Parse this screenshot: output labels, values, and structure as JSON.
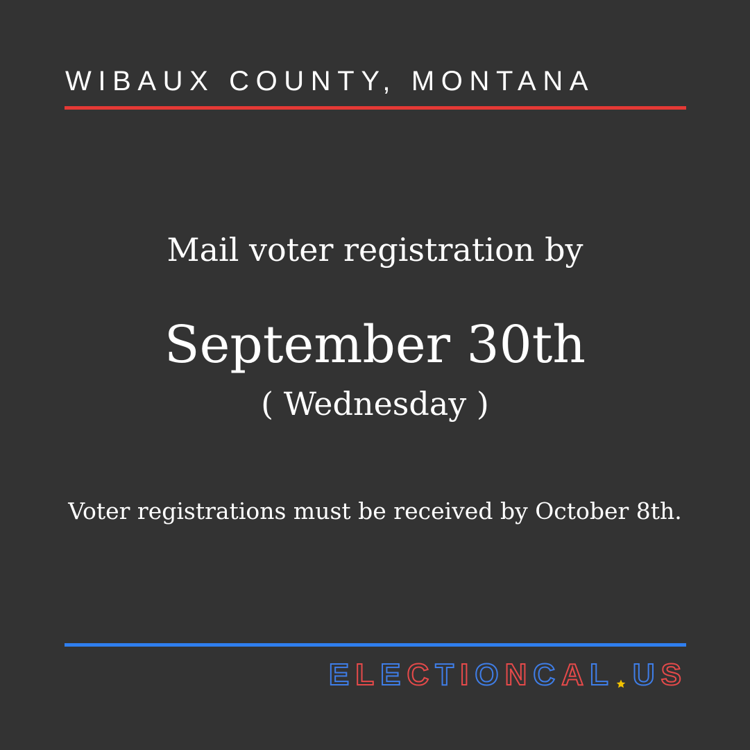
{
  "header": {
    "county": "WIBAUX COUNTY, MONTANA"
  },
  "main": {
    "headline": "Mail voter registration by",
    "date": "September 30th",
    "weekday": "( Wednesday )",
    "note": "Voter registrations must be received by October 8th."
  },
  "footer": {
    "brand_text": "ELECTIONCAL.US",
    "brand_letters": [
      {
        "char": "E",
        "color": "blue"
      },
      {
        "char": "L",
        "color": "red"
      },
      {
        "char": "E",
        "color": "blue"
      },
      {
        "char": "C",
        "color": "red"
      },
      {
        "char": "T",
        "color": "blue"
      },
      {
        "char": "I",
        "color": "red"
      },
      {
        "char": "O",
        "color": "blue"
      },
      {
        "char": "N",
        "color": "red"
      },
      {
        "char": "C",
        "color": "blue"
      },
      {
        "char": "A",
        "color": "red"
      },
      {
        "char": "L",
        "color": "blue"
      },
      {
        "char": "U",
        "color": "blue"
      },
      {
        "char": "S",
        "color": "red"
      }
    ],
    "star_icon": "star-icon"
  },
  "colors": {
    "background": "#333333",
    "text": "#ffffff",
    "top_rule": "#e53935",
    "bottom_rule": "#2f7ff0",
    "brand_red": "#e64a4a",
    "brand_blue": "#3f7ee8",
    "star": "#f2c200"
  }
}
